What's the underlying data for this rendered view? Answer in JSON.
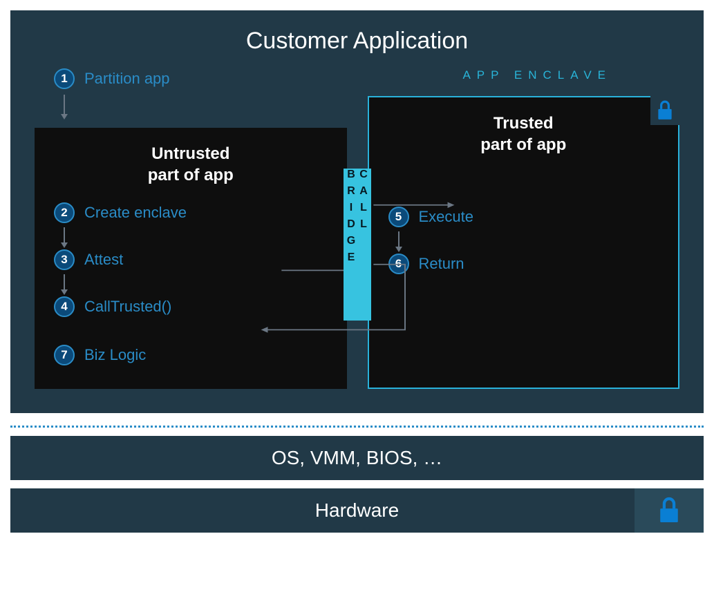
{
  "title": "Customer Application",
  "bridge_label": "CALL BRIDGE",
  "enclave_label": "APP ENCLAVE",
  "untrusted": {
    "title_l1": "Untrusted",
    "title_l2": "part of app"
  },
  "trusted": {
    "title_l1": "Trusted",
    "title_l2": "part of app"
  },
  "steps": {
    "s1": {
      "n": "1",
      "label": "Partition app"
    },
    "s2": {
      "n": "2",
      "label": "Create enclave"
    },
    "s3": {
      "n": "3",
      "label": "Attest"
    },
    "s4": {
      "n": "4",
      "label": "CallTrusted()"
    },
    "s5": {
      "n": "5",
      "label": "Execute"
    },
    "s6": {
      "n": "6",
      "label": "Return"
    },
    "s7": {
      "n": "7",
      "label": "Biz Logic"
    }
  },
  "layers": {
    "os": "OS, VMM, BIOS, …",
    "hw": "Hardware"
  }
}
